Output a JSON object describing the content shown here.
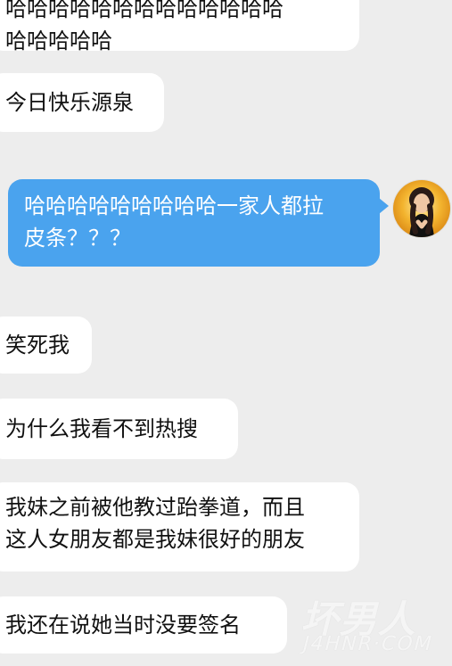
{
  "messages": [
    {
      "text": "哈哈哈哈哈哈哈哈哈哈哈哈哈\n哈哈哈哈哈"
    },
    {
      "text": "今日快乐源泉"
    },
    {
      "text": "哈哈哈哈哈哈哈哈哈一家人都拉\n皮条？？？"
    },
    {
      "text": "笑死我"
    },
    {
      "text": "为什么我看不到热搜"
    },
    {
      "text": "我妹之前被他教过跆拳道，而且\n这人女朋友都是我妹很好的朋友"
    },
    {
      "text": "我还在说她当时没要签名"
    }
  ],
  "watermark": {
    "main": "坏男人",
    "sub": "J4HNR·COM"
  },
  "colors": {
    "background": "#ededed",
    "incoming_bubble": "#ffffff",
    "outgoing_bubble": "#4aa3ee"
  },
  "icons": {
    "avatar": "user-avatar"
  }
}
